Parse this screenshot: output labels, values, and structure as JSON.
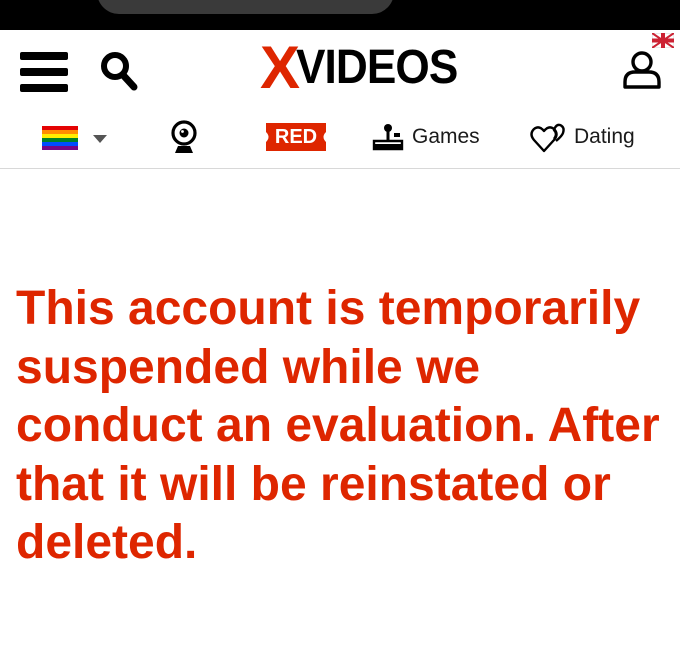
{
  "header": {
    "logo_first": "X",
    "logo_rest": "VIDEOS"
  },
  "nav": {
    "red_label": "RED",
    "games_label": "Games",
    "dating_label": "Dating"
  },
  "message": {
    "text": "This account is temporarily suspended while we conduct an evaluation. After that it will be reinstated or deleted."
  },
  "icons": {
    "menu": "hamburger-menu-icon",
    "search": "search-icon",
    "user": "user-icon",
    "language_flag": "uk-flag-icon",
    "filter_flag": "rainbow-flag-icon",
    "webcam": "webcam-icon",
    "games": "joystick-icon",
    "dating": "hearts-icon"
  },
  "colors": {
    "brand_red": "#de2600",
    "text_dark": "#1a1a1a",
    "background": "#ffffff"
  }
}
